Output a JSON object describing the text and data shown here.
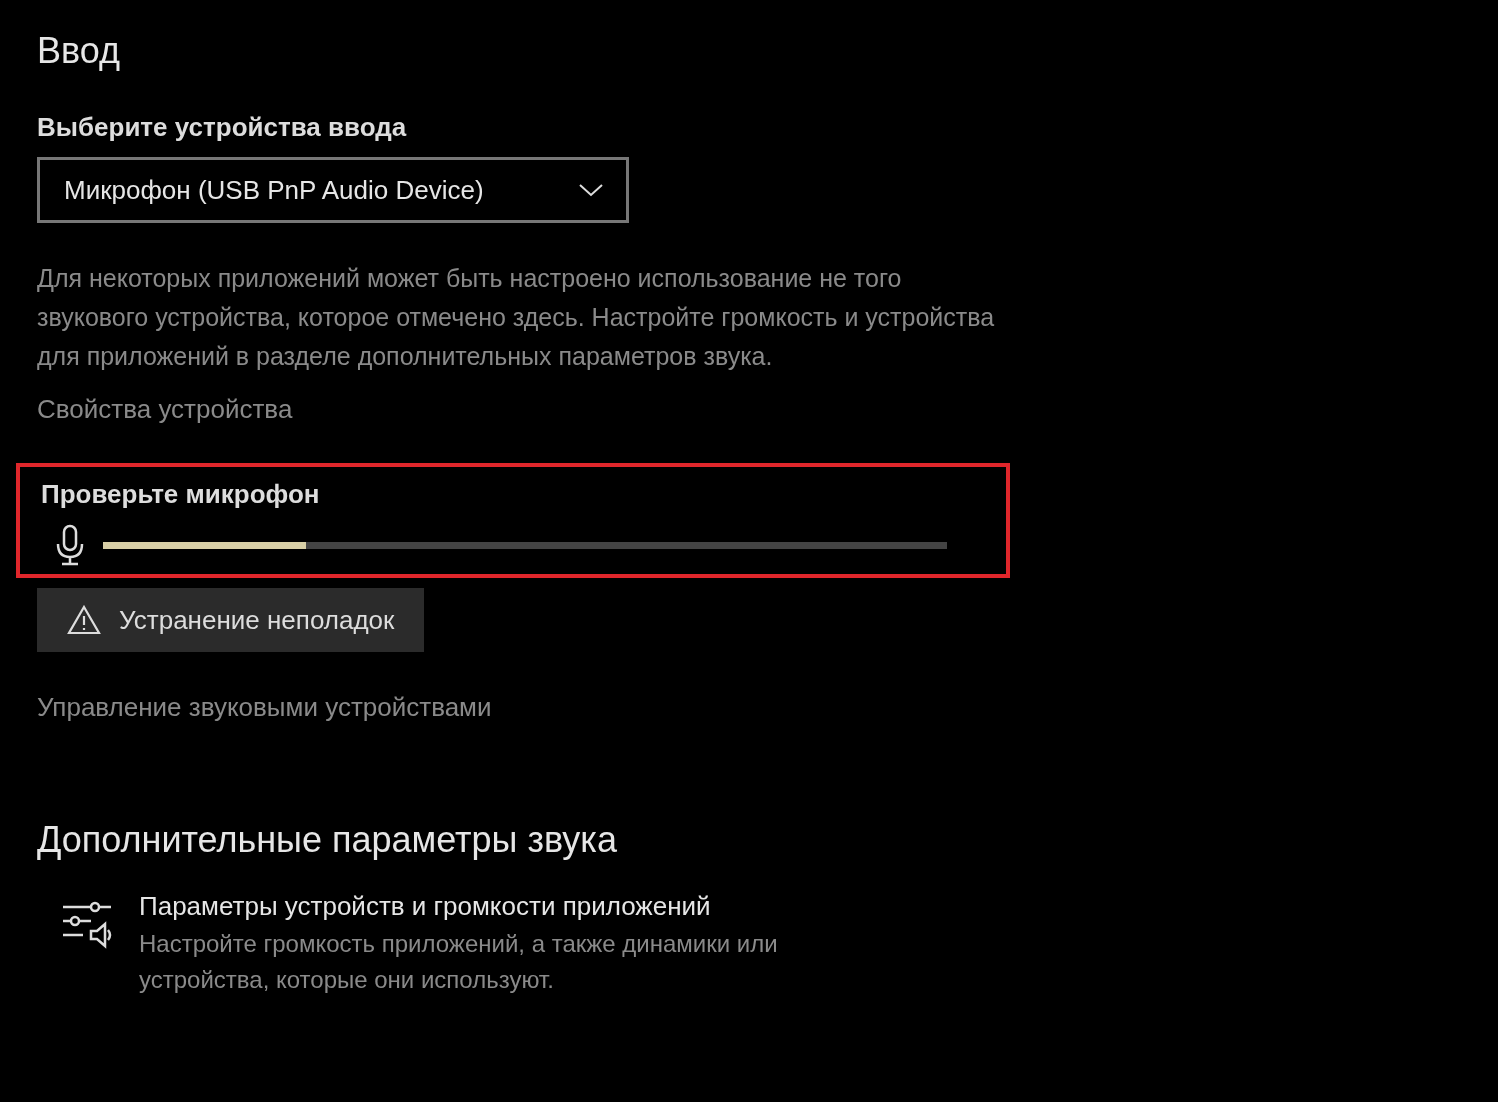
{
  "section_title": "Ввод",
  "device_select": {
    "label": "Выберите устройства ввода",
    "value": "Микрофон (USB PnP Audio Device)"
  },
  "description": "Для некоторых приложений может быть настроено использование не того звукового устройства, которое отмечено здесь. Настройте громкость и устройства для приложений в разделе дополнительных параметров звука.",
  "device_properties_link": "Свойства устройства",
  "mic_test": {
    "label": "Проверьте микрофон",
    "level": 0.24,
    "highlighted": true
  },
  "troubleshoot_button": "Устранение неполадок",
  "manage_link": "Управление звуковыми устройствами",
  "advanced": {
    "title": "Дополнительные параметры звука",
    "items": [
      {
        "title": "Параметры устройств и громкости приложений",
        "description": "Настройте громкость приложений, а также динамики или устройства, которые они используют."
      }
    ]
  }
}
